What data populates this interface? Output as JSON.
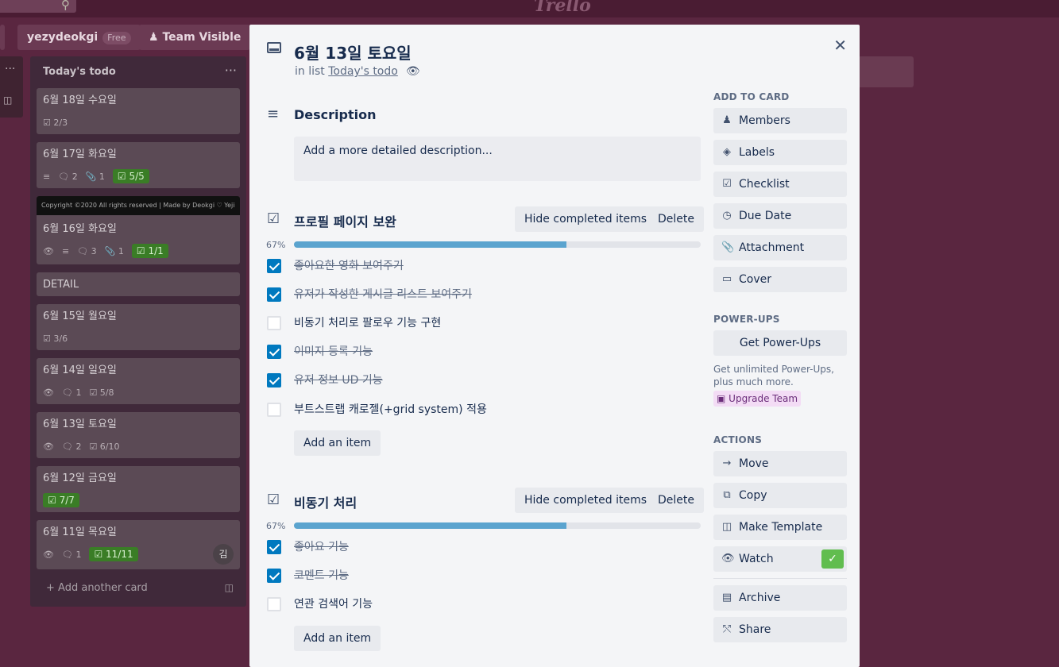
{
  "topbar": {
    "logo": "Trello"
  },
  "boardbar": {
    "workspace": "yezydeokgi",
    "free_badge": "Free",
    "visibility": "Team Visible"
  },
  "list": {
    "title": "Today's todo",
    "add_card": "Add another card",
    "cards": [
      {
        "title": "6월 18일 수요일",
        "checklist": "2/3"
      },
      {
        "title": "6월 17일 화요일",
        "comments": "2",
        "attachments": "1",
        "checklist": "5/5"
      },
      {
        "title": "6월 16일 화요일",
        "cover": "Copyright ©2020 All rights reserved | Made by Deokgi ♡ Yeji",
        "comments": "3",
        "attachments": "1",
        "checklist": "1/1"
      },
      {
        "title": "DETAIL"
      },
      {
        "title": "6월 15일 월요일",
        "checklist": "3/6"
      },
      {
        "title": "6월 14일 일요일",
        "comments": "1",
        "checklist": "5/8"
      },
      {
        "title": "6월 13일 토요일",
        "comments": "2",
        "checklist": "6/10"
      },
      {
        "title": "6월 12일 금요일",
        "checklist": "7/7"
      },
      {
        "title": "6월 11일 목요일",
        "comments": "1",
        "checklist": "11/11",
        "avatar": "김"
      }
    ]
  },
  "modal": {
    "title": "6월 13일 토요일",
    "in_list_prefix": "in list",
    "in_list_name": "Today's todo",
    "description": {
      "heading": "Description",
      "placeholder": "Add a more detailed description..."
    },
    "checklists": [
      {
        "title": "프로필 페이지 보완",
        "percent": "67%",
        "progress": 0.67,
        "hide_label": "Hide completed items",
        "delete_label": "Delete",
        "add_label": "Add an item",
        "items": [
          {
            "text": "좋아요한 영화 보여주기",
            "done": true
          },
          {
            "text": "유저가 작성한 게시글 리스트 보여주기",
            "done": true
          },
          {
            "text": "비동기 처리로 팔로우 기능 구현",
            "done": false
          },
          {
            "text": "이미지 등록 기능",
            "done": true
          },
          {
            "text": "유저 정보 UD 기능",
            "done": true
          },
          {
            "text": "부트스트랩 캐로젤(+grid system) 적용",
            "done": false
          }
        ]
      },
      {
        "title": "비동기 처리",
        "percent": "67%",
        "progress": 0.67,
        "hide_label": "Hide completed items",
        "delete_label": "Delete",
        "add_label": "Add an item",
        "items": [
          {
            "text": "좋아요 기능",
            "done": true
          },
          {
            "text": "코멘트 기능",
            "done": true
          },
          {
            "text": "연관 검색어 기능",
            "done": false
          }
        ]
      }
    ],
    "sidebar": {
      "add_to_card_heading": "ADD TO CARD",
      "add_to_card": [
        "Members",
        "Labels",
        "Checklist",
        "Due Date",
        "Attachment",
        "Cover"
      ],
      "powerups_heading": "POWER-UPS",
      "get_powerups": "Get Power-Ups",
      "powerups_note": "Get unlimited Power-Ups, plus much more.",
      "upgrade": "Upgrade Team",
      "actions_heading": "ACTIONS",
      "actions": [
        "Move",
        "Copy",
        "Make Template",
        "Watch",
        "Archive",
        "Share"
      ]
    }
  },
  "colors": {
    "accent": "#0079bf",
    "progress": "#5ba4cf",
    "green": "#61bd4f",
    "board": "#5a2640"
  }
}
